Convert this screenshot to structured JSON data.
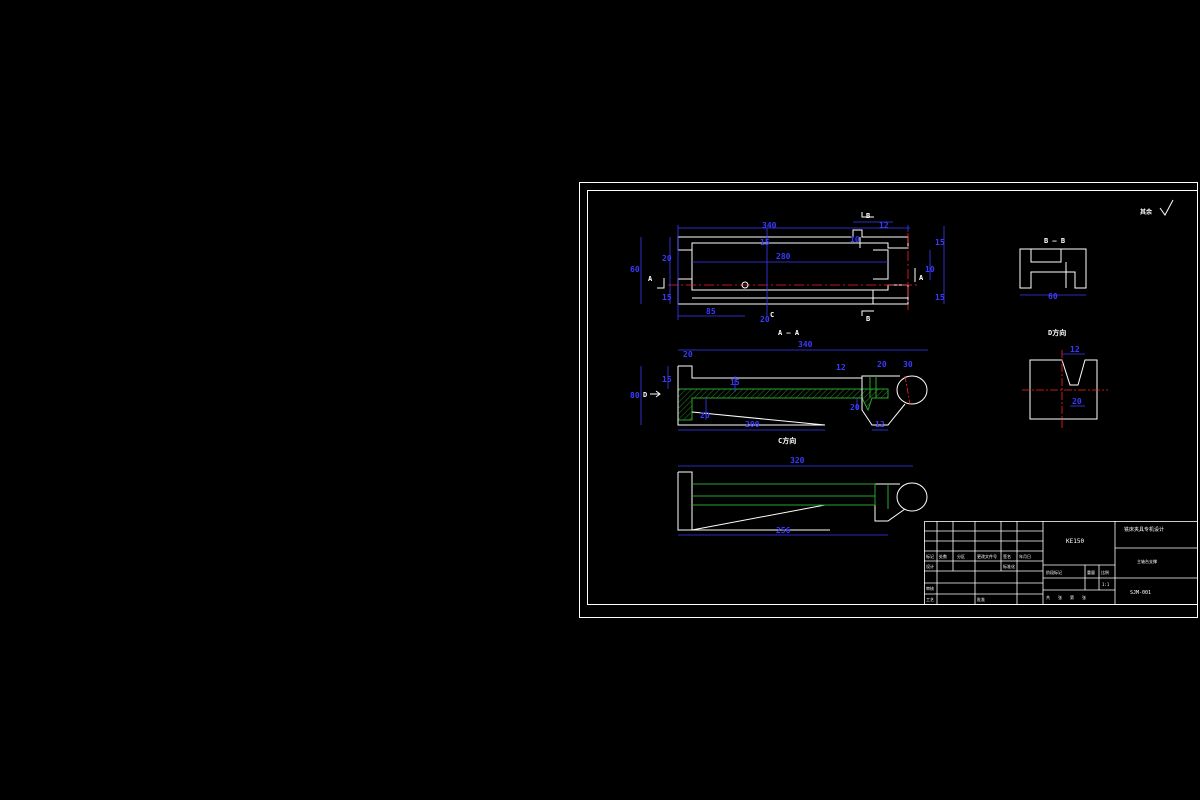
{
  "colors": {
    "background": "#000000",
    "outline": "#ffffff",
    "dimension": "#3a3aff",
    "centerline": "#ff2020",
    "hatch": "#2aa52a",
    "hidden": "#2aa52a"
  },
  "views": {
    "plan": {
      "dims": [
        "340",
        "280",
        "12",
        "20",
        "60",
        "15",
        "10",
        "15",
        "10",
        "15",
        "85",
        "15",
        "20"
      ],
      "labels": [
        "B",
        "B",
        "A",
        "A",
        "C"
      ]
    },
    "section_aa": {
      "title": "A — A",
      "dims": [
        "340",
        "12",
        "20",
        "30",
        "20",
        "15",
        "80",
        "15",
        "20",
        "200",
        "20",
        "12"
      ],
      "labels": [
        "D"
      ]
    },
    "view_c": {
      "title": "C方向",
      "dims": [
        "320",
        "256"
      ]
    },
    "section_bb": {
      "title": "B — B",
      "dims": [
        "60"
      ]
    },
    "view_d": {
      "title": "D方向",
      "dims": [
        "12",
        "20"
      ]
    }
  },
  "roughness_note": "其余",
  "title_block": {
    "part_code": "KE150",
    "company": "铣床夹具专机设计",
    "drawing_name": "主轴台支撑",
    "drawing_number": "SJM-001",
    "scale": "1:1",
    "row_labels": [
      "标记",
      "设计",
      "审核",
      "工艺"
    ],
    "cells": [
      "处数",
      "分区",
      "更改文件号",
      "签名",
      "年月日",
      "标准化",
      "阶段标记",
      "重量",
      "比例",
      "共",
      "张",
      "第",
      "张",
      "批准"
    ]
  }
}
